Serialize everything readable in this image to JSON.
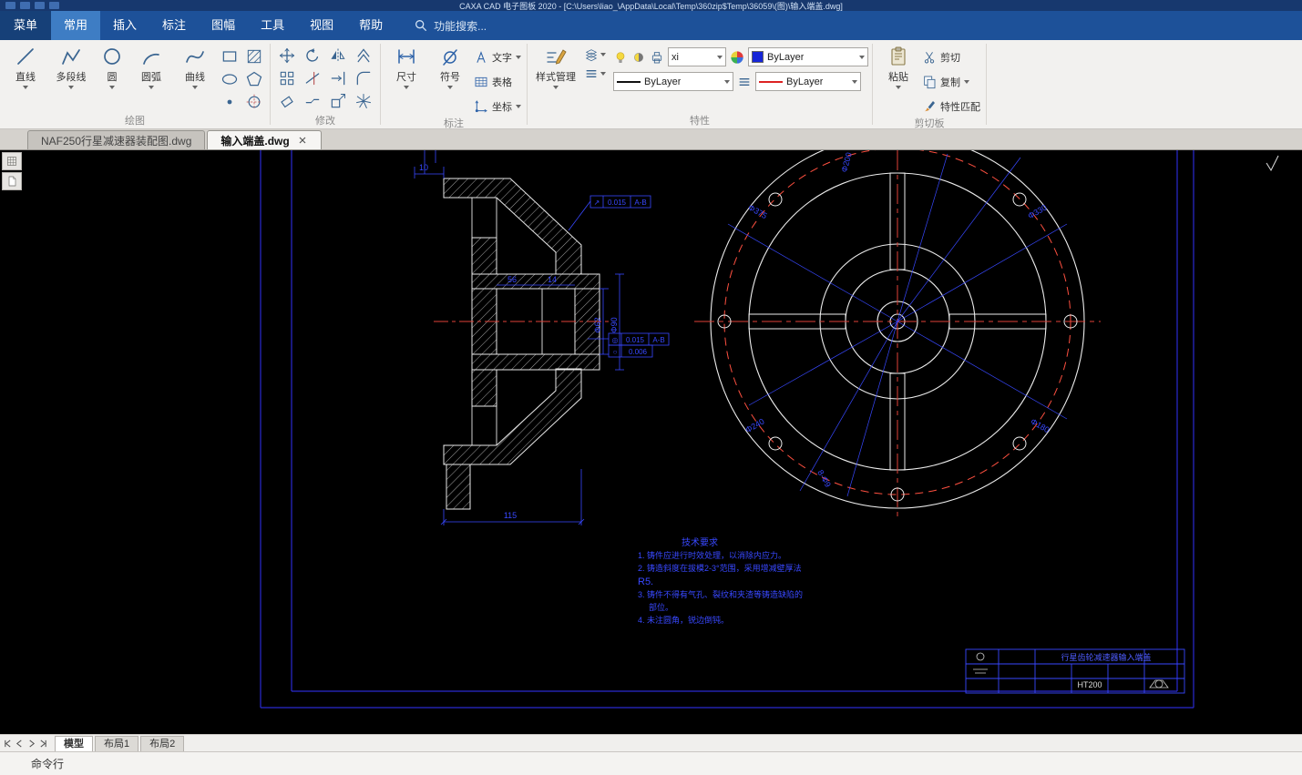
{
  "window": {
    "title": "CAXA CAD 电子图板 2020 - [C:\\Users\\liao_\\AppData\\Local\\Temp\\360zip$Temp\\36059\\(图)\\输入端盖.dwg]"
  },
  "colors": {
    "menubar": "#1d5199",
    "active_tab": "#3e7dc4",
    "canvas_line": "#ececec",
    "center_red": "#e04238",
    "dim_blue": "#3848ff"
  },
  "menu": {
    "button": "菜单",
    "t1": "常用",
    "t2": "插入",
    "t3": "标注",
    "t4": "图幅",
    "t5": "工具",
    "t6": "视图",
    "t7": "帮助",
    "search": "功能搜索..."
  },
  "ribbon": {
    "draw": {
      "label": "绘图",
      "b1": "直线",
      "b2": "多段线",
      "b3": "圆",
      "b4": "圆弧",
      "b5": "曲线"
    },
    "modify": {
      "label": "修改"
    },
    "annotate": {
      "label": "标注",
      "b1": "尺寸",
      "b2": "符号",
      "s1": "文字",
      "s2": "表格",
      "s3": "坐标"
    },
    "props": {
      "label": "特性",
      "style": "样式管理",
      "layer": "xi",
      "linetype": "ByLayer",
      "color": "ByLayer",
      "lineweight": "ByLayer"
    },
    "clip": {
      "label": "剪切板",
      "paste": "粘贴",
      "cut": "剪切",
      "copy": "复制",
      "match": "特性匹配"
    }
  },
  "doc_tabs": {
    "t1": "NAF250行星减速器装配图.dwg",
    "t2": "输入端盖.dwg"
  },
  "layout": {
    "model": "模型",
    "l1": "布局1",
    "l2": "布局2"
  },
  "command": {
    "label": "命令行"
  },
  "drawing": {
    "dimensions": {
      "w10": "10",
      "w56": "56",
      "w14": "14",
      "w115": "115",
      "dia62": "Φ62",
      "dia90": "Φ90",
      "dia200": "Φ200"
    },
    "fcf": {
      "s1": "↗",
      "v1": "0.015",
      "d1": "A-B",
      "s2": "◎",
      "v2": "0.015",
      "d2": "A-B",
      "s3": "○",
      "v3": "0.006"
    },
    "radial": {
      "r1": "Φ330",
      "r2": "Φ375",
      "r3": "Φ240",
      "r4": "Φ180",
      "r5": "8-Φ9"
    },
    "tech": {
      "title": "技术要求",
      "l1": "1. 铸件应进行时效处理，以消除内应力。",
      "l2": "2. 铸造斜度在拔模2-3°范围，采用增减壁厚法",
      "l3": "R5.",
      "l4": "3. 铸件不得有气孔、裂纹和夹渣等铸造缺陷的",
      "l5": "部位。",
      "l6": "4. 未注圆角，锐边倒钝。"
    },
    "title_block": {
      "part_name": "行星齿轮减速器输入端盖",
      "material": "HT200"
    }
  }
}
